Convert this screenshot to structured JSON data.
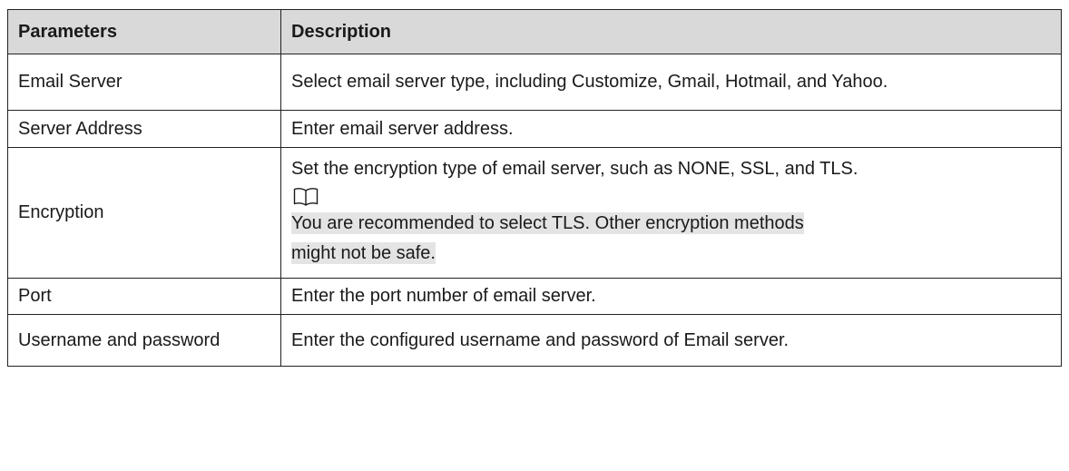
{
  "table": {
    "headers": {
      "parameters": "Parameters",
      "description": "Description"
    },
    "rows": [
      {
        "parameter": "Email Server",
        "description": "Select email server type, including Customize, Gmail, Hotmail, and Yahoo."
      },
      {
        "parameter": "Server Address",
        "description": "Enter email server address."
      },
      {
        "parameter": "Encryption",
        "description": "Set the encryption type of email server, such as NONE, SSL, and TLS.",
        "note_icon": "book-note-icon",
        "note_line1": "You are recommended to select TLS. Other encryption methods",
        "note_line2": "might not be safe."
      },
      {
        "parameter": "Port",
        "description": "Enter the port number of email server."
      },
      {
        "parameter": "Username and password",
        "description": "Enter the configured username and password of Email server."
      }
    ]
  },
  "colors": {
    "header_background": "#d9d9d9",
    "note_highlight": "#e4e4e4",
    "border": "#222222"
  }
}
